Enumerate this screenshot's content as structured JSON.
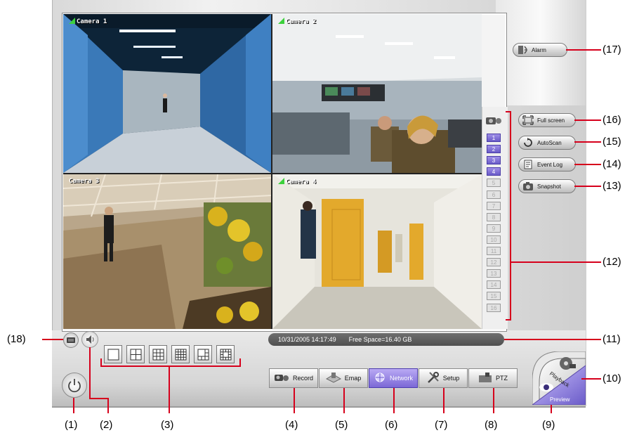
{
  "cameras": [
    {
      "label": "Camera 1",
      "signal": true
    },
    {
      "label": "Camera 2",
      "signal": true
    },
    {
      "label": "Camera 3",
      "signal": false
    },
    {
      "label": "Camera 4",
      "signal": true
    }
  ],
  "channels": {
    "items": [
      "1",
      "2",
      "3",
      "4",
      "5",
      "6",
      "7",
      "8",
      "9",
      "10",
      "11",
      "12",
      "13",
      "14",
      "15",
      "16"
    ],
    "active_count": 4
  },
  "side_buttons": {
    "alarm": "Alarm",
    "full_screen": "Full screen",
    "autoscan": "AutoScan",
    "event_log": "Event Log",
    "snapshot": "Snapshot"
  },
  "status": {
    "datetime": "10/31/2005 14:17:49",
    "free_space": "Free Space=16.40 GB"
  },
  "toolbar": {
    "record": "Record",
    "emap": "Emap",
    "network": "Network",
    "setup": "Setup",
    "ptz": "PTZ",
    "playback": "Playback",
    "preview": "Preview"
  },
  "callouts": [
    "(1)",
    "(2)",
    "(3)",
    "(4)",
    "(5)",
    "(6)",
    "(7)",
    "(8)",
    "(9)",
    "(10)",
    "(11)",
    "(12)",
    "(13)",
    "(14)",
    "(15)",
    "(16)",
    "(17)",
    "(18)"
  ],
  "colors": {
    "accent": "#7b68d6",
    "callout_line": "#d6001c",
    "signal": "#3dd13d"
  },
  "icons": [
    "keyboard-icon",
    "speaker-icon",
    "power-icon",
    "camera-icon",
    "alarm-icon",
    "fullscreen-icon",
    "autoscan-icon",
    "eventlog-icon",
    "snapshot-icon",
    "record-icon",
    "emap-icon",
    "network-icon",
    "setup-icon",
    "ptz-icon",
    "playback-icon",
    "preview-icon"
  ]
}
